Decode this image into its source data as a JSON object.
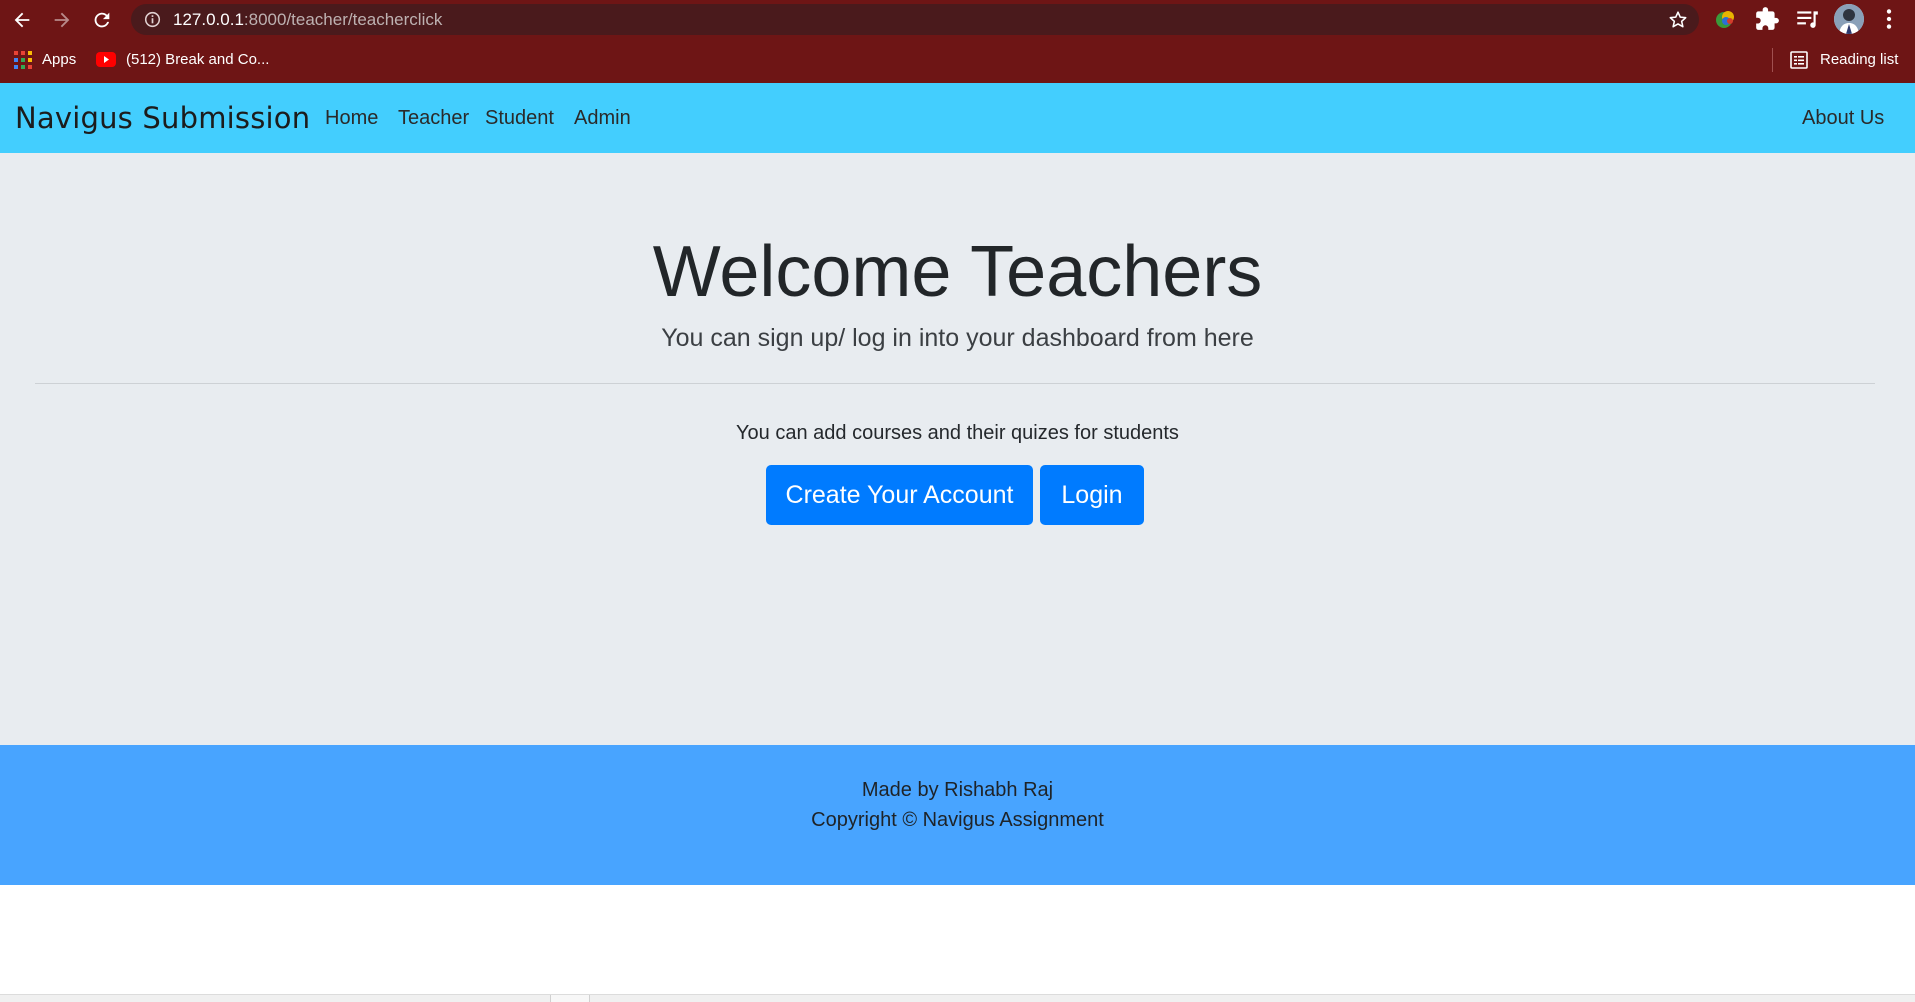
{
  "browser": {
    "url_host": "127.0.0.1",
    "url_path": ":8000/teacher/teacherclick",
    "bookmarks": {
      "apps_label": "Apps",
      "youtube_label": "(512) Break and Co...",
      "reading_list_label": "Reading list"
    },
    "icons": [
      "back-icon",
      "forward-icon",
      "reload-icon",
      "site-info-icon",
      "bookmark-star-icon",
      "extension-colorful-icon",
      "extensions-puzzle-icon",
      "media-queue-icon",
      "profile-avatar",
      "more-menu-icon",
      "apps-grid-icon",
      "youtube-icon",
      "reading-list-icon"
    ]
  },
  "navbar": {
    "brand": "Navigus Submission",
    "links": [
      "Home",
      "Teacher",
      "Student",
      "Admin"
    ],
    "right_link": "About Us",
    "background": "#43cefe"
  },
  "jumbotron": {
    "title": "Welcome Teachers",
    "lead": "You can sign up/ log in into your dashboard from here",
    "text": "You can add courses and their quizes for students",
    "create_button": "Create Your Account",
    "login_button": "Login",
    "background": "#e8ecf0",
    "button_color": "#007bff"
  },
  "footer": {
    "line1": "Made by Rishabh Raj",
    "line2": "Copyright © Navigus Assignment",
    "background": "#48a4ff"
  }
}
